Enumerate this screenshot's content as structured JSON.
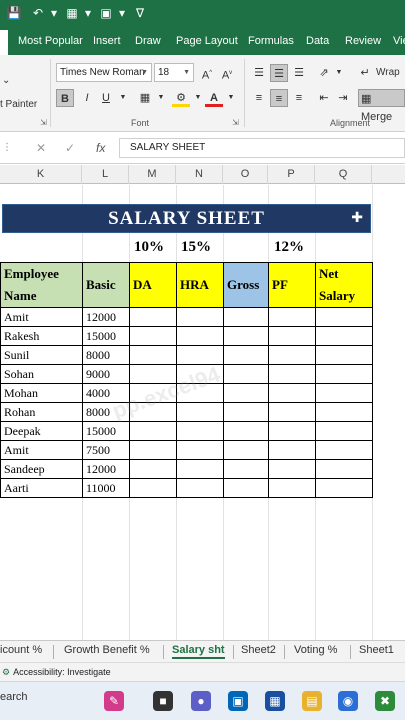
{
  "ribbon_tabs": [
    "Most Popular",
    "Insert",
    "Draw",
    "Page Layout",
    "Formulas",
    "Data",
    "Review",
    "Vie"
  ],
  "clipboard": {
    "format_painter_label": "t Painter"
  },
  "font": {
    "name": "Times New Roman",
    "size": "18",
    "group_label": "Font"
  },
  "alignment": {
    "wrap_label": "Wrap",
    "merge_label": "Merge",
    "group_label": "Alignment"
  },
  "formula_bar": {
    "fx_label": "fx",
    "content": "SALARY  SHEET"
  },
  "columns": [
    "K",
    "L",
    "M",
    "N",
    "O",
    "P",
    "Q"
  ],
  "sheet": {
    "title": "SALARY  SHEET",
    "percentages": {
      "da": "10%",
      "hra": "15%",
      "pf": "12%"
    },
    "headers": {
      "employee": "Employee Name",
      "basic": "Basic",
      "da": "DA",
      "hra": "HRA",
      "gross": "Gross",
      "pf": "PF",
      "net": "Net Salary"
    },
    "rows": [
      {
        "name": "Amit",
        "basic": "12000"
      },
      {
        "name": "Rakesh",
        "basic": "15000"
      },
      {
        "name": "Sunil",
        "basic": "8000"
      },
      {
        "name": "Sohan",
        "basic": "9000"
      },
      {
        "name": "Mohan",
        "basic": "4000"
      },
      {
        "name": "Rohan",
        "basic": "8000"
      },
      {
        "name": "Deepak",
        "basic": "15000"
      },
      {
        "name": "Amit",
        "basic": "7500"
      },
      {
        "name": "Sandeep",
        "basic": "12000"
      },
      {
        "name": "Aarti",
        "basic": "11000"
      }
    ],
    "watermark": "pp.excel94"
  },
  "sheet_tabs": [
    "icount %",
    "Growth Benefit %",
    "Salary sht",
    "Sheet2",
    "Voting %",
    "Sheet1"
  ],
  "active_sheet": "Salary sht",
  "status": {
    "accessibility": "Accessibility: Investigate"
  },
  "taskbar": {
    "search_label": "earch"
  },
  "colors": {
    "excel_green": "#1e7145",
    "title_fill": "#1f3864",
    "header_green": "#c6e0b4",
    "header_yellow": "#ffff00",
    "gross_blue": "#9dc3e6"
  }
}
